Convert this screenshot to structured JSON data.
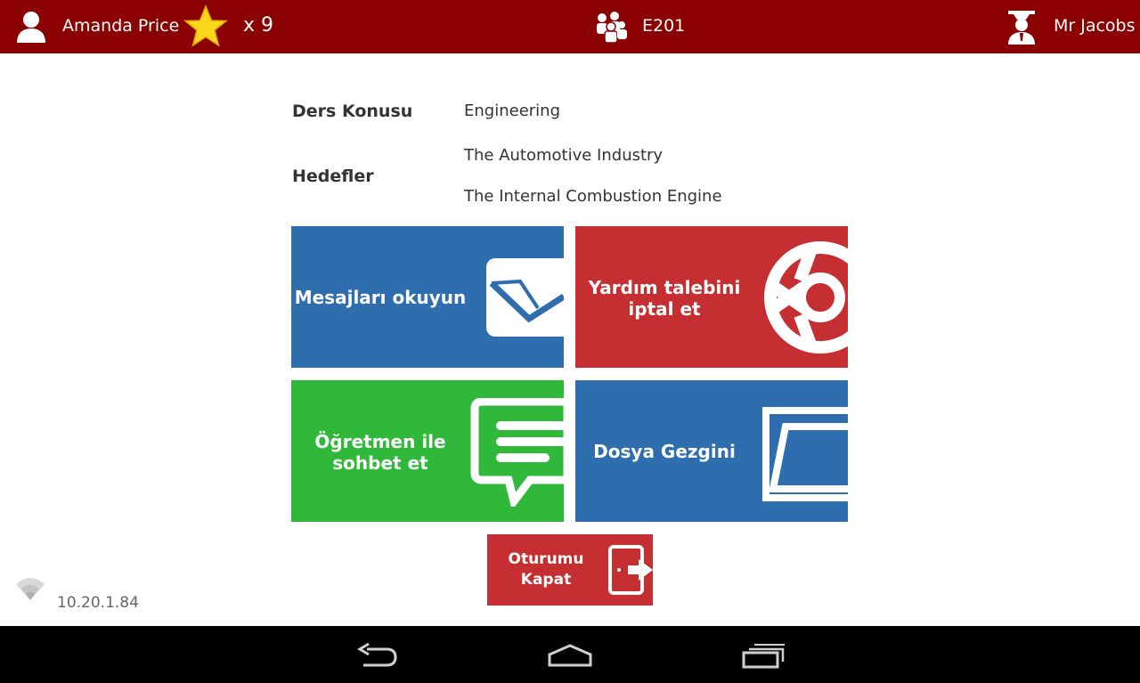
{
  "header": {
    "user_name": "Amanda Price",
    "star_count": "x 9",
    "room": "E201",
    "teacher_name": "Mr Jacobs"
  },
  "lesson": {
    "subject_label": "Ders Konusu",
    "subject_value": "Engineering",
    "goals_label": "Hedefler",
    "goals": [
      "The Automotive Industry",
      "The Internal Combustion Engine"
    ]
  },
  "tiles": {
    "read_messages": "Mesajları okuyun",
    "cancel_help_line1": "Yardım talebini",
    "cancel_help_line2": "iptal et",
    "chat_teacher_line1": "Öğretmen ile",
    "chat_teacher_line2": "sohbet et",
    "file_explorer": "Dosya Gezgini",
    "logout_line1": "Oturumu",
    "logout_line2": "Kapat"
  },
  "status": {
    "ip_address": "10.20.1.84"
  },
  "colors": {
    "header_bg": "#8b0000",
    "tile_blue": "#2e6eae",
    "tile_red": "#c62f32",
    "tile_green": "#2fb83a"
  }
}
